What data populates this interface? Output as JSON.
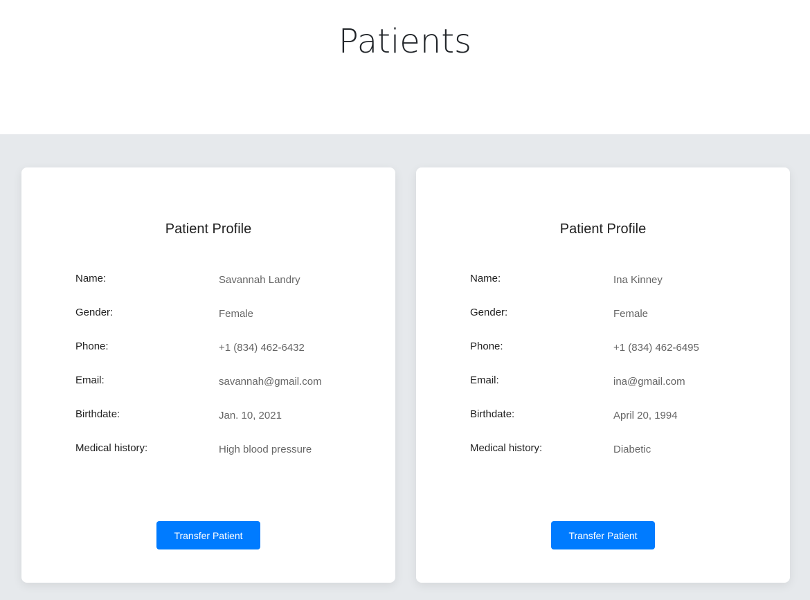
{
  "page_title": "Patients",
  "labels": {
    "name": "Name:",
    "gender": "Gender:",
    "phone": "Phone:",
    "email": "Email:",
    "birthdate": "Birthdate:",
    "medical_history": "Medical history:"
  },
  "patients": [
    {
      "card_title": "Patient Profile",
      "name": "Savannah Landry",
      "gender": "Female",
      "phone": "+1 (834) 462-6432",
      "email": "savannah@gmail.com",
      "birthdate": "Jan. 10, 2021",
      "medical_history": "High blood pressure",
      "button_label": "Transfer Patient"
    },
    {
      "card_title": "Patient Profile",
      "name": "Ina Kinney",
      "gender": "Female",
      "phone": "+1 (834) 462-6495",
      "email": "ina@gmail.com",
      "birthdate": "April 20, 1994",
      "medical_history": "Diabetic",
      "button_label": "Transfer Patient"
    }
  ],
  "colors": {
    "accent": "#007bff",
    "background": "#e6e9ec"
  }
}
